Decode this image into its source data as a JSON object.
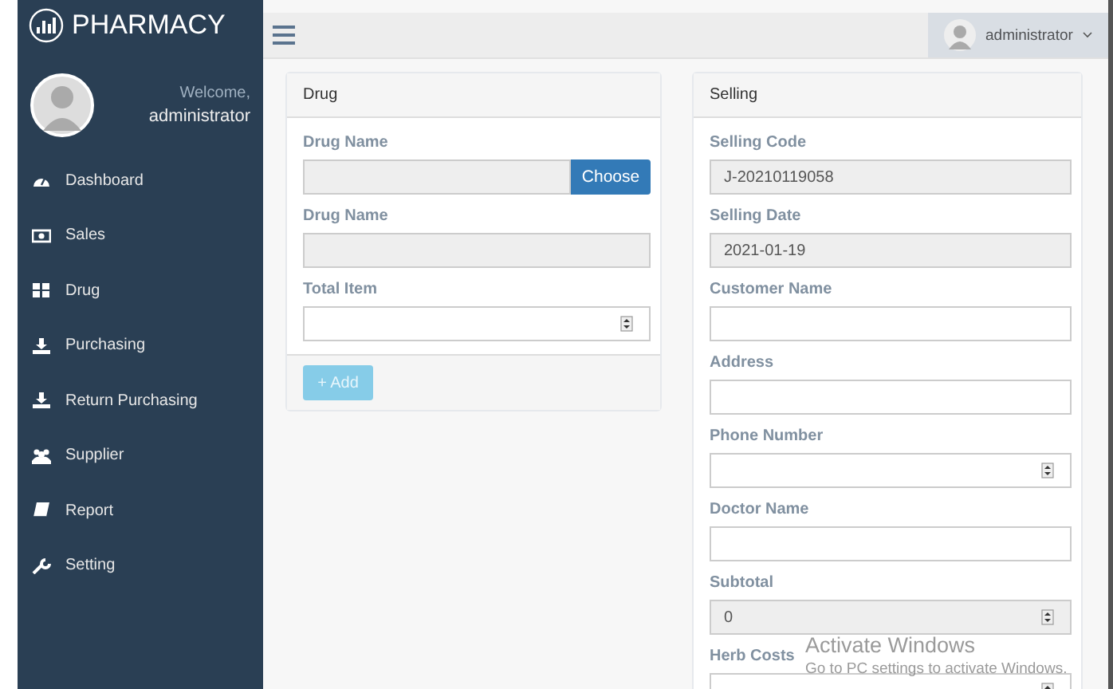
{
  "brand": {
    "title": "PHARMACY"
  },
  "profile": {
    "greeting": "Welcome,",
    "name": "administrator"
  },
  "sidebar": {
    "items": [
      {
        "label": "Dashboard"
      },
      {
        "label": "Sales"
      },
      {
        "label": "Drug"
      },
      {
        "label": "Purchasing"
      },
      {
        "label": "Return Purchasing"
      },
      {
        "label": "Supplier"
      },
      {
        "label": "Report"
      },
      {
        "label": "Setting"
      }
    ]
  },
  "topbar": {
    "user": "administrator"
  },
  "drug_panel": {
    "title": "Drug",
    "fields": [
      {
        "label": "Drug Name",
        "kind": "choose",
        "readonly": true,
        "button": "Choose"
      },
      {
        "label": "Drug Name",
        "kind": "text",
        "readonly": true
      },
      {
        "label": "Total Item",
        "kind": "number",
        "readonly": false
      }
    ],
    "add_button": {
      "label": "+ Add",
      "disabled": true
    }
  },
  "selling_panel": {
    "title": "Selling",
    "fields": [
      {
        "label": "Selling Code",
        "kind": "text",
        "readonly": true,
        "value": "J-20210119058"
      },
      {
        "label": "Selling Date",
        "kind": "text",
        "readonly": true,
        "value": "2021-01-19"
      },
      {
        "label": "Customer Name",
        "kind": "text",
        "readonly": false
      },
      {
        "label": "Address",
        "kind": "text",
        "readonly": false
      },
      {
        "label": "Phone Number",
        "kind": "number",
        "readonly": false
      },
      {
        "label": "Doctor Name",
        "kind": "text",
        "readonly": false
      },
      {
        "label": "Subtotal",
        "kind": "number",
        "readonly": true,
        "value": "0"
      },
      {
        "label": "Herb Costs",
        "kind": "number",
        "readonly": false
      }
    ]
  },
  "os_notice": {
    "title": "Activate Windows",
    "subtitle": "Go to PC settings to activate Windows."
  }
}
